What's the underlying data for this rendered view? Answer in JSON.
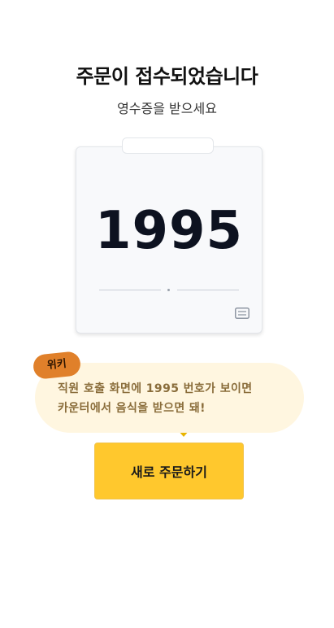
{
  "header": {
    "title": "주문이 접수되었습니다",
    "subtitle": "영수증을 받으세요"
  },
  "ticket": {
    "order_number": "1995",
    "icon": "receipt-icon"
  },
  "speech": {
    "speaker": "위키",
    "line1": "직원 호출 화면에 1995 번호가 보이면",
    "line2": "카운터에서 음식을 받으면 돼!"
  },
  "actions": {
    "new_order_label": "새로 주문하기"
  },
  "colors": {
    "accent": "#ffc82d",
    "speaker_badge": "#e0802a",
    "bubble_bg": "#fff6e0",
    "bubble_text": "#8a6d3b",
    "order_number": "#0d1220"
  }
}
